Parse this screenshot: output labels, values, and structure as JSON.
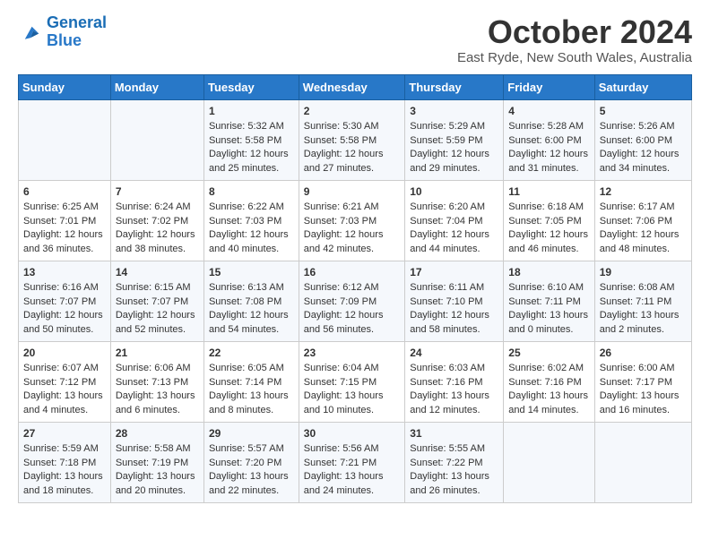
{
  "logo": {
    "line1": "General",
    "line2": "Blue"
  },
  "title": "October 2024",
  "subtitle": "East Ryde, New South Wales, Australia",
  "days_of_week": [
    "Sunday",
    "Monday",
    "Tuesday",
    "Wednesday",
    "Thursday",
    "Friday",
    "Saturday"
  ],
  "weeks": [
    [
      {
        "day": "",
        "sunrise": "",
        "sunset": "",
        "daylight": ""
      },
      {
        "day": "",
        "sunrise": "",
        "sunset": "",
        "daylight": ""
      },
      {
        "day": "1",
        "sunrise": "Sunrise: 5:32 AM",
        "sunset": "Sunset: 5:58 PM",
        "daylight": "Daylight: 12 hours and 25 minutes."
      },
      {
        "day": "2",
        "sunrise": "Sunrise: 5:30 AM",
        "sunset": "Sunset: 5:58 PM",
        "daylight": "Daylight: 12 hours and 27 minutes."
      },
      {
        "day": "3",
        "sunrise": "Sunrise: 5:29 AM",
        "sunset": "Sunset: 5:59 PM",
        "daylight": "Daylight: 12 hours and 29 minutes."
      },
      {
        "day": "4",
        "sunrise": "Sunrise: 5:28 AM",
        "sunset": "Sunset: 6:00 PM",
        "daylight": "Daylight: 12 hours and 31 minutes."
      },
      {
        "day": "5",
        "sunrise": "Sunrise: 5:26 AM",
        "sunset": "Sunset: 6:00 PM",
        "daylight": "Daylight: 12 hours and 34 minutes."
      }
    ],
    [
      {
        "day": "6",
        "sunrise": "Sunrise: 6:25 AM",
        "sunset": "Sunset: 7:01 PM",
        "daylight": "Daylight: 12 hours and 36 minutes."
      },
      {
        "day": "7",
        "sunrise": "Sunrise: 6:24 AM",
        "sunset": "Sunset: 7:02 PM",
        "daylight": "Daylight: 12 hours and 38 minutes."
      },
      {
        "day": "8",
        "sunrise": "Sunrise: 6:22 AM",
        "sunset": "Sunset: 7:03 PM",
        "daylight": "Daylight: 12 hours and 40 minutes."
      },
      {
        "day": "9",
        "sunrise": "Sunrise: 6:21 AM",
        "sunset": "Sunset: 7:03 PM",
        "daylight": "Daylight: 12 hours and 42 minutes."
      },
      {
        "day": "10",
        "sunrise": "Sunrise: 6:20 AM",
        "sunset": "Sunset: 7:04 PM",
        "daylight": "Daylight: 12 hours and 44 minutes."
      },
      {
        "day": "11",
        "sunrise": "Sunrise: 6:18 AM",
        "sunset": "Sunset: 7:05 PM",
        "daylight": "Daylight: 12 hours and 46 minutes."
      },
      {
        "day": "12",
        "sunrise": "Sunrise: 6:17 AM",
        "sunset": "Sunset: 7:06 PM",
        "daylight": "Daylight: 12 hours and 48 minutes."
      }
    ],
    [
      {
        "day": "13",
        "sunrise": "Sunrise: 6:16 AM",
        "sunset": "Sunset: 7:07 PM",
        "daylight": "Daylight: 12 hours and 50 minutes."
      },
      {
        "day": "14",
        "sunrise": "Sunrise: 6:15 AM",
        "sunset": "Sunset: 7:07 PM",
        "daylight": "Daylight: 12 hours and 52 minutes."
      },
      {
        "day": "15",
        "sunrise": "Sunrise: 6:13 AM",
        "sunset": "Sunset: 7:08 PM",
        "daylight": "Daylight: 12 hours and 54 minutes."
      },
      {
        "day": "16",
        "sunrise": "Sunrise: 6:12 AM",
        "sunset": "Sunset: 7:09 PM",
        "daylight": "Daylight: 12 hours and 56 minutes."
      },
      {
        "day": "17",
        "sunrise": "Sunrise: 6:11 AM",
        "sunset": "Sunset: 7:10 PM",
        "daylight": "Daylight: 12 hours and 58 minutes."
      },
      {
        "day": "18",
        "sunrise": "Sunrise: 6:10 AM",
        "sunset": "Sunset: 7:11 PM",
        "daylight": "Daylight: 13 hours and 0 minutes."
      },
      {
        "day": "19",
        "sunrise": "Sunrise: 6:08 AM",
        "sunset": "Sunset: 7:11 PM",
        "daylight": "Daylight: 13 hours and 2 minutes."
      }
    ],
    [
      {
        "day": "20",
        "sunrise": "Sunrise: 6:07 AM",
        "sunset": "Sunset: 7:12 PM",
        "daylight": "Daylight: 13 hours and 4 minutes."
      },
      {
        "day": "21",
        "sunrise": "Sunrise: 6:06 AM",
        "sunset": "Sunset: 7:13 PM",
        "daylight": "Daylight: 13 hours and 6 minutes."
      },
      {
        "day": "22",
        "sunrise": "Sunrise: 6:05 AM",
        "sunset": "Sunset: 7:14 PM",
        "daylight": "Daylight: 13 hours and 8 minutes."
      },
      {
        "day": "23",
        "sunrise": "Sunrise: 6:04 AM",
        "sunset": "Sunset: 7:15 PM",
        "daylight": "Daylight: 13 hours and 10 minutes."
      },
      {
        "day": "24",
        "sunrise": "Sunrise: 6:03 AM",
        "sunset": "Sunset: 7:16 PM",
        "daylight": "Daylight: 13 hours and 12 minutes."
      },
      {
        "day": "25",
        "sunrise": "Sunrise: 6:02 AM",
        "sunset": "Sunset: 7:16 PM",
        "daylight": "Daylight: 13 hours and 14 minutes."
      },
      {
        "day": "26",
        "sunrise": "Sunrise: 6:00 AM",
        "sunset": "Sunset: 7:17 PM",
        "daylight": "Daylight: 13 hours and 16 minutes."
      }
    ],
    [
      {
        "day": "27",
        "sunrise": "Sunrise: 5:59 AM",
        "sunset": "Sunset: 7:18 PM",
        "daylight": "Daylight: 13 hours and 18 minutes."
      },
      {
        "day": "28",
        "sunrise": "Sunrise: 5:58 AM",
        "sunset": "Sunset: 7:19 PM",
        "daylight": "Daylight: 13 hours and 20 minutes."
      },
      {
        "day": "29",
        "sunrise": "Sunrise: 5:57 AM",
        "sunset": "Sunset: 7:20 PM",
        "daylight": "Daylight: 13 hours and 22 minutes."
      },
      {
        "day": "30",
        "sunrise": "Sunrise: 5:56 AM",
        "sunset": "Sunset: 7:21 PM",
        "daylight": "Daylight: 13 hours and 24 minutes."
      },
      {
        "day": "31",
        "sunrise": "Sunrise: 5:55 AM",
        "sunset": "Sunset: 7:22 PM",
        "daylight": "Daylight: 13 hours and 26 minutes."
      },
      {
        "day": "",
        "sunrise": "",
        "sunset": "",
        "daylight": ""
      },
      {
        "day": "",
        "sunrise": "",
        "sunset": "",
        "daylight": ""
      }
    ]
  ]
}
